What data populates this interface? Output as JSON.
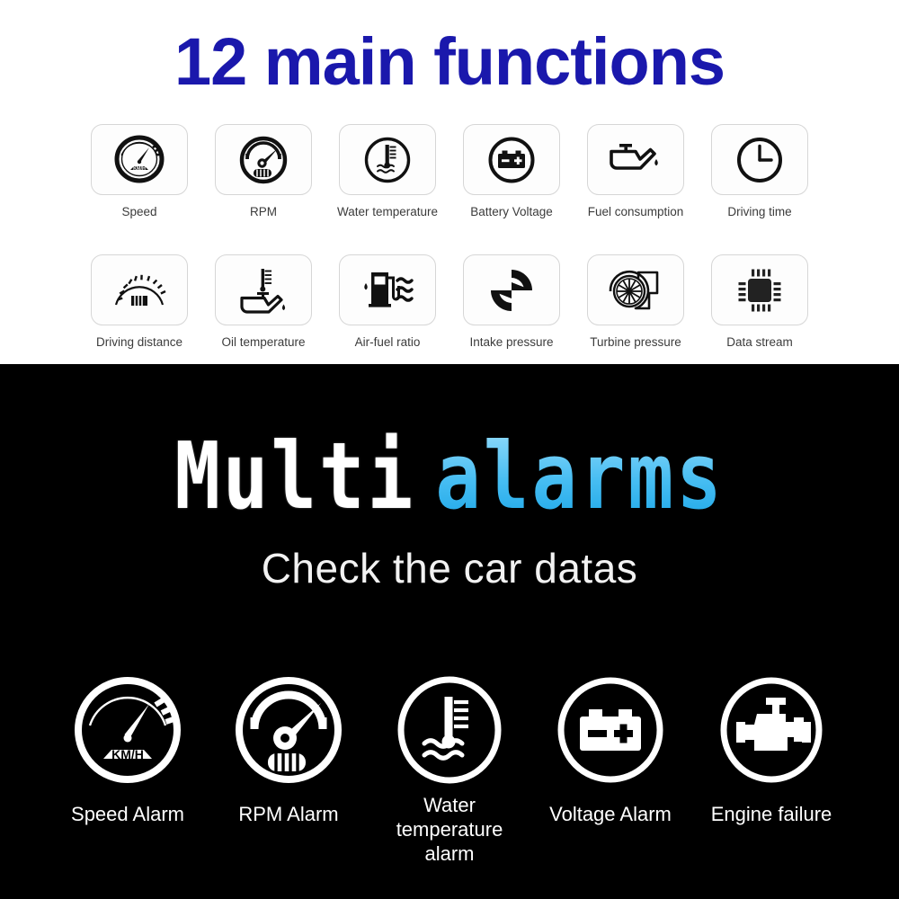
{
  "top": {
    "title": "12 main functions",
    "title_color": "#1a18ac",
    "background_color": "#ffffff",
    "functions": [
      {
        "label": "Speed",
        "icon": "speedometer-kmh-icon"
      },
      {
        "label": "RPM",
        "icon": "rpm-tachometer-icon"
      },
      {
        "label": "Water temperature",
        "icon": "water-temperature-icon"
      },
      {
        "label": "Battery Voltage",
        "icon": "battery-voltage-icon"
      },
      {
        "label": "Fuel consumption",
        "icon": "oil-can-fuel-icon"
      },
      {
        "label": "Driving time",
        "icon": "clock-icon"
      },
      {
        "label": "Driving distance",
        "icon": "odometer-dial-icon"
      },
      {
        "label": "Oil temperature",
        "icon": "oil-temperature-icon"
      },
      {
        "label": "Air-fuel ratio",
        "icon": "fuel-pump-waves-icon"
      },
      {
        "label": "Intake pressure",
        "icon": "recycle-arrows-icon"
      },
      {
        "label": "Turbine pressure",
        "icon": "turbocharger-icon"
      },
      {
        "label": "Data stream",
        "icon": "microchip-icon"
      }
    ]
  },
  "bottom": {
    "background_color": "#000000",
    "heading_part1": "Multi",
    "heading_part2": "alarms",
    "heading_part1_color": "#ffffff",
    "heading_part2_color": "#46bdf2",
    "subtitle": "Check the car datas",
    "alarms": [
      {
        "label": "Speed Alarm",
        "icon": "speed-alarm-gauge-icon",
        "lines": 1
      },
      {
        "label": "RPM Alarm",
        "icon": "rpm-alarm-gauge-icon",
        "lines": 1
      },
      {
        "label": "Water\ntemperature alarm",
        "icon": "water-temperature-alarm-icon",
        "lines": 2
      },
      {
        "label": "Voltage Alarm",
        "icon": "voltage-alarm-battery-icon",
        "lines": 1
      },
      {
        "label": "Engine failure",
        "icon": "engine-failure-icon",
        "lines": 1
      }
    ]
  }
}
